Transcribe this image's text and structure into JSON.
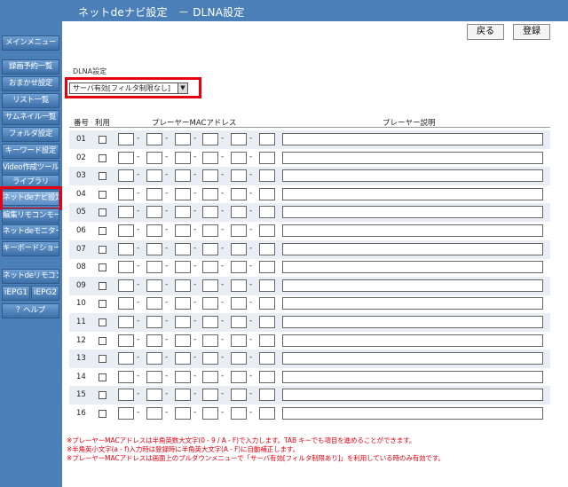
{
  "header": {
    "title": "ネットdeナビ設定　－ DLNA設定"
  },
  "toolbar": {
    "back_label": "戻る",
    "register_label": "登録"
  },
  "sidebar": {
    "main_menu": "メインメニュー",
    "items": [
      {
        "label": "録画予約一覧"
      },
      {
        "label": "おまかせ設定"
      },
      {
        "label": "リスト一覧"
      },
      {
        "label": "サムネイル一覧"
      },
      {
        "label": "フォルダ設定"
      },
      {
        "label": "キーワード設定"
      },
      {
        "label": "Video作成ツール"
      },
      {
        "label": "ライブラリ"
      },
      {
        "label": "ネットdeナビ設定"
      },
      {
        "label": "編集リモコンモード"
      },
      {
        "label": "ネットdeモニター"
      },
      {
        "label": "キーボードショートカット"
      }
    ],
    "remote": "ネットdeリモコン",
    "iepg1": "iEPG1",
    "iepg2": "iEPG2",
    "help": "？ヘルプ"
  },
  "dlna": {
    "label": "DLNA設定",
    "selected": "サーバ有効[フィルタ制限なし]"
  },
  "table": {
    "col_no": "番号",
    "col_use": "利用",
    "col_mac": "プレーヤーMACアドレス",
    "col_desc": "プレーヤー説明",
    "rows": [
      "01",
      "02",
      "03",
      "04",
      "05",
      "06",
      "07",
      "08",
      "09",
      "10",
      "11",
      "12",
      "13",
      "14",
      "15",
      "16"
    ]
  },
  "notes": [
    "※プレーヤーMACアドレスは半角英数大文字(0 - 9 / A - F)で入力します。TAB キーでも項目を進めることができます。",
    "※半角英小文字(a - f)入力時は登録時に半角英大文字(A - F)に自動補正します。",
    "※プレーヤーMACアドレスは画面上のプルダウンメニューで「サーバ有効[フィルタ制限あり]」を利用している時のみ有効です。"
  ],
  "colors": {
    "sidebar": "#4a7fb8",
    "highlight": "#e60012",
    "note": "#e60012"
  }
}
